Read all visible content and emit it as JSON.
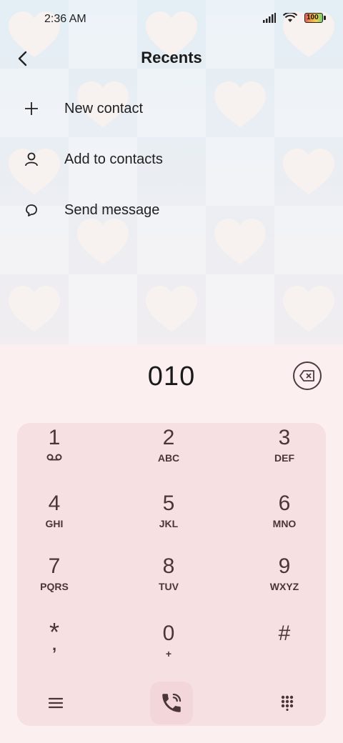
{
  "status": {
    "time": "2:36 AM",
    "battery_text": "100"
  },
  "header": {
    "title": "Recents"
  },
  "actions": [
    {
      "label": "New contact",
      "icon": "plus-icon"
    },
    {
      "label": "Add to contacts",
      "icon": "person-icon"
    },
    {
      "label": "Send message",
      "icon": "chat-bubble-icon"
    }
  ],
  "dialer": {
    "number": "010",
    "keys": [
      {
        "digit": "1",
        "letters": ""
      },
      {
        "digit": "2",
        "letters": "ABC"
      },
      {
        "digit": "3",
        "letters": "DEF"
      },
      {
        "digit": "4",
        "letters": "GHI"
      },
      {
        "digit": "5",
        "letters": "JKL"
      },
      {
        "digit": "6",
        "letters": "MNO"
      },
      {
        "digit": "7",
        "letters": "PQRS"
      },
      {
        "digit": "8",
        "letters": "TUV"
      },
      {
        "digit": "9",
        "letters": "WXYZ"
      },
      {
        "digit": "*",
        "letters": ","
      },
      {
        "digit": "0",
        "letters": "+"
      },
      {
        "digit": "#",
        "letters": ""
      }
    ]
  },
  "colors": {
    "wallpaper_blue": "#e6eef5",
    "wallpaper_pink": "#f3eaee",
    "heart": "#f7f1ef",
    "keypad_bg": "#f6e0e2",
    "key_text": "#4a3539"
  }
}
